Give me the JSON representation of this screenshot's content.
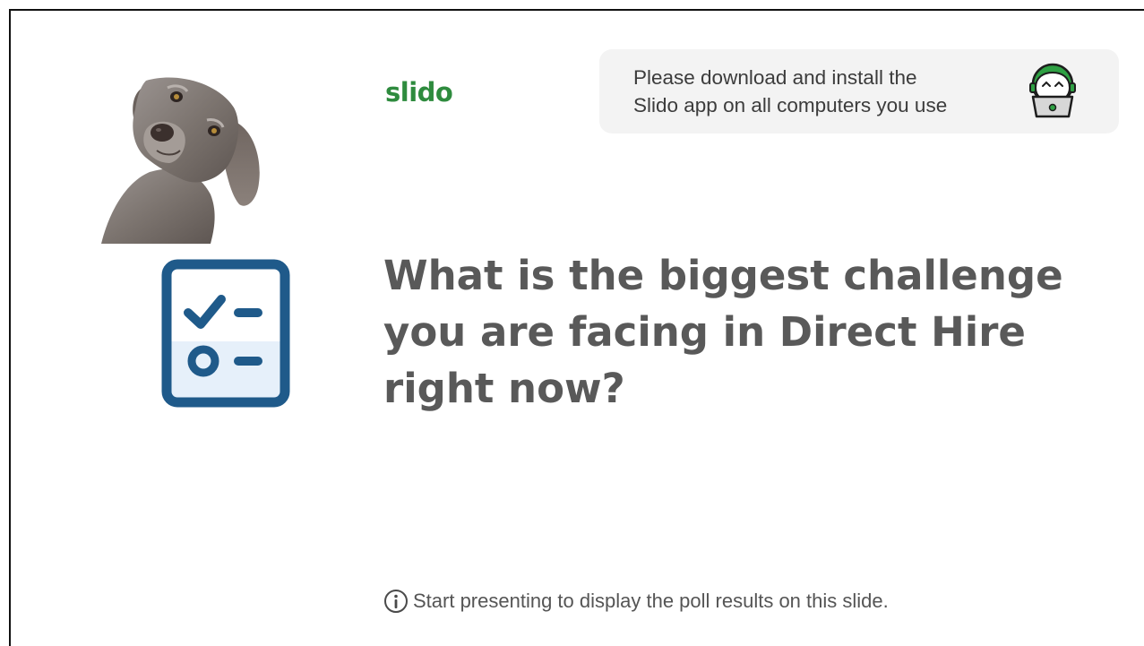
{
  "slide": {
    "logo": "slido",
    "notice": {
      "line1": "Please download and install the",
      "line2": "Slido app on all computers you use"
    },
    "question": {
      "line1": "What is the biggest challenge",
      "line2": "you are facing in Direct Hire",
      "line3": "right now?"
    },
    "footer_text": "Start presenting to display the poll results on this slide.",
    "icons": {
      "dog": "dog-image",
      "poll": "poll-checklist-icon",
      "mascot": "slido-mascot-laptop-icon",
      "info": "info-icon"
    },
    "colors": {
      "brand_green": "#2e8b3e",
      "poll_icon_blue": "#1f5a8a",
      "question_gray": "#595959",
      "notice_bg": "#f3f3f3"
    }
  }
}
